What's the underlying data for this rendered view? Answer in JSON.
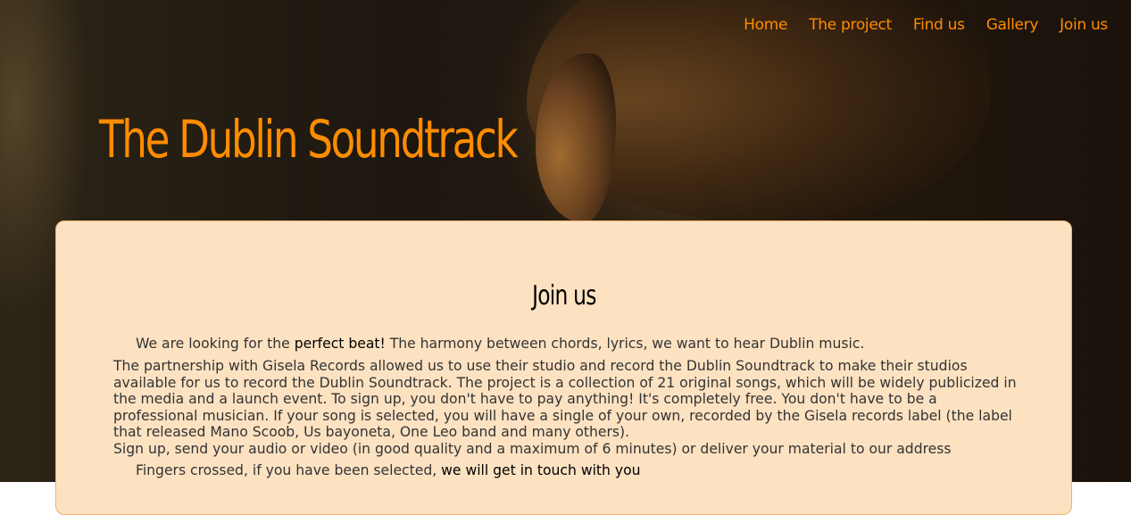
{
  "nav": {
    "items": [
      {
        "label": "Home"
      },
      {
        "label": "The project"
      },
      {
        "label": "Find us"
      },
      {
        "label": "Gallery"
      },
      {
        "label": "Join us"
      }
    ]
  },
  "hero": {
    "title": "The Dublin Soundtrack"
  },
  "card": {
    "heading": "Join us",
    "p1_before": "We are looking for the ",
    "p1_highlight": "perfect beat!",
    "p1_after": " The harmony between chords, lyrics, we want to hear Dublin music.",
    "p2": "The partnership with Gisela Records allowed us to use their studio and record the Dublin Soundtrack to make their studios available for us to record the Dublin Soundtrack. The project is a collection of 21 original songs, which will be widely publicized in the media and a launch event. To sign up, you don't have to pay anything! It's completely free. You don't have to be a professional musician. If your song is selected, you will have a single of your own, recorded by the Gisela records label (the label that released Mano Scoob, Us bayoneta, One Leo band and many others).",
    "p3": "Sign up, send your audio or video (in good quality and a maximum of 6 minutes) or deliver your material to our address",
    "p4_before": "Fingers crossed, if you have been selected, ",
    "p4_highlight": "we will get in touch with you"
  },
  "colors": {
    "accent": "#ff8c00",
    "card_background": "#fde2c2",
    "card_border": "#f0b070"
  }
}
